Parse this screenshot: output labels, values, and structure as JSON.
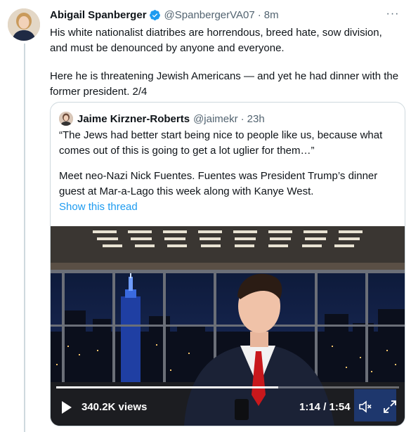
{
  "tweet": {
    "author_name": "Abigail Spanberger",
    "handle": "@SpanbergerVA07",
    "separator": "·",
    "time": "8m",
    "more_label": "···",
    "paragraph_1": "His white nationalist diatribes are horrendous, breed hate, sow division, and must be denounced by anyone and everyone.",
    "paragraph_2": "Here he is threatening Jewish Americans — and yet he had dinner with the former president. 2/4"
  },
  "quote": {
    "author_name": "Jaime Kirzner-Roberts",
    "handle": "@jaimekr",
    "separator": "·",
    "time": "23h",
    "paragraph_1": "“The Jews had better start being nice to people like us, because what comes out of this is going to get a lot uglier for them…”",
    "paragraph_2": "Meet neo-Nazi Nick Fuentes. Fuentes was President Trump’s dinner guest at Mar-a-Lago this week along with Kanye West.",
    "show_thread": "Show this thread"
  },
  "video": {
    "views": "340.2K views",
    "timestamp": "1:14 / 1:54",
    "progress": 0.647
  },
  "colors": {
    "link": "#1d9bf0",
    "verified": "#1d9bf0",
    "secondary_text": "#536471",
    "border": "#cfd9de"
  }
}
